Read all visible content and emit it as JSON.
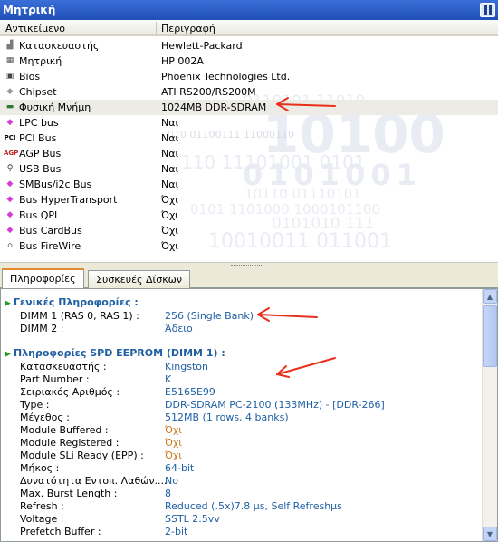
{
  "window": {
    "title": "Μητρική"
  },
  "list": {
    "columns": [
      "Αντικείμενο",
      "Περιγραφή"
    ],
    "rows": [
      {
        "icon": "factory-icon",
        "name": "Κατασκευαστής",
        "value": "Hewlett-Packard"
      },
      {
        "icon": "motherboard-icon",
        "name": "Μητρική",
        "value": "HP 002A"
      },
      {
        "icon": "bios-chip-icon",
        "name": "Bios",
        "value": "Phoenix Technologies Ltd."
      },
      {
        "icon": "chipset-icon",
        "name": "Chipset",
        "value": "ATI RS200/RS200M"
      },
      {
        "icon": "ram-module-icon",
        "name": "Φυσική Μνήμη",
        "value": "1024MB DDR-SDRAM"
      },
      {
        "icon": "bus-diamond-icon",
        "name": "LPC bus",
        "value": "Ναι"
      },
      {
        "icon": "pci-icon",
        "name": "PCI Bus",
        "value": "Ναι"
      },
      {
        "icon": "agp-icon",
        "name": "AGP Bus",
        "value": "Ναι"
      },
      {
        "icon": "usb-icon",
        "name": "USB Bus",
        "value": "Ναι"
      },
      {
        "icon": "bus-diamond-icon",
        "name": "SMBus/i2c Bus",
        "value": "Ναι"
      },
      {
        "icon": "bus-diamond-icon",
        "name": "Bus HyperTransport",
        "value": "Όχι"
      },
      {
        "icon": "bus-diamond-icon",
        "name": "Bus QPI",
        "value": "Όχι"
      },
      {
        "icon": "bus-diamond-icon",
        "name": "Bus CardBus",
        "value": "Όχι"
      },
      {
        "icon": "firewire-icon",
        "name": "Bus FireWire",
        "value": "Όχι"
      }
    ]
  },
  "watermark": [
    "0110101  11010",
    "10100",
    "010  01100111  11000110",
    "110  11101001  0101",
    "0101001",
    "10110  01110101",
    "0101  1101000  1000101100",
    "0101010  111",
    "10010011  011001"
  ],
  "tabs": [
    "Πληροφορίες",
    "Συσκευές Δίσκων"
  ],
  "details": {
    "general": {
      "title": "Γενικές Πληροφορίες :",
      "rows": [
        {
          "key": "DIMM 1 (RAS 0, RAS 1) :",
          "value": "256 (Single Bank)"
        },
        {
          "key": "DIMM 2 :",
          "value": "Άδειο"
        }
      ]
    },
    "spd": {
      "title": "Πληροφορίες SPD EEPROM (DIMM 1) :",
      "rows": [
        {
          "key": "Κατασκευαστής :",
          "value": "Kingston"
        },
        {
          "key": "Part Number :",
          "value": "K"
        },
        {
          "key": "Σειριακός Αριθμός :",
          "value": "E5165E99"
        },
        {
          "key": "Type :",
          "value": "DDR-SDRAM PC-2100 (133MHz)  -  [DDR-266]"
        },
        {
          "key": "Μέγεθος :",
          "value": "512MB (1 rows, 4 banks)"
        },
        {
          "key": "Module Buffered :",
          "value": "Όχι",
          "accent": true
        },
        {
          "key": "Module Registered :",
          "value": "Όχι",
          "accent": true
        },
        {
          "key": "Module SLi Ready (EPP) :",
          "value": "Όχι",
          "accent": true
        },
        {
          "key": "Μήκος :",
          "value": "64-bit"
        },
        {
          "key": "Δυνατότητα Εντοπ. Λαθών....",
          "value": "No"
        },
        {
          "key": "Max. Burst Length :",
          "value": "8"
        },
        {
          "key": "Refresh :",
          "value": "Reduced (.5x)7.8 µs, Self Refreshµs"
        },
        {
          "key": "Voltage :",
          "value": "SSTL 2.5vv"
        },
        {
          "key": "Prefetch Buffer :",
          "value": "2-bit"
        }
      ]
    }
  },
  "colors": {
    "accent": "#1f5fa3",
    "titlebar": "#2a5bc4",
    "arrow": "#e8301c",
    "value_no": "#c8781e"
  }
}
